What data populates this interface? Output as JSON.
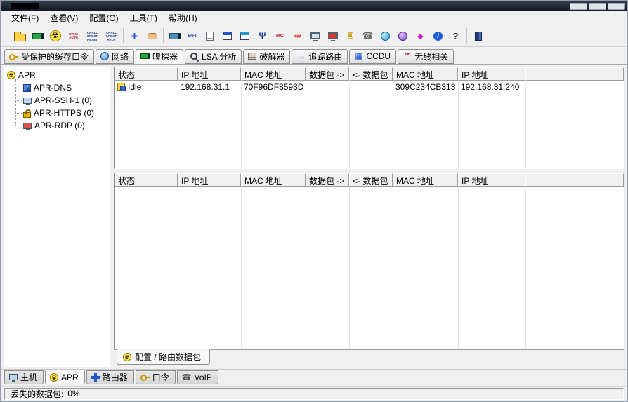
{
  "icons": {
    "radiation": "☢",
    "phone": "☎",
    "plus": "+",
    "b64": "B64",
    "fork": "Ψ",
    "mc": "MC",
    "asterisks": "***",
    "tower": "♜",
    "plug": "◆",
    "info": "i",
    "help": "?",
    "ntlm": "NTLM AUTH",
    "chall_reset": "CHALL SPOOF RESET",
    "chall_htlh": "CHALL SPOOF HTLH",
    "route_arrow": "→",
    "ccdu_grid": "▦",
    "wireless": "””"
  },
  "menubar": {
    "items": [
      {
        "label": "文件(F)"
      },
      {
        "label": "查看(V)"
      },
      {
        "label": "配置(O)"
      },
      {
        "label": "工具(T)"
      },
      {
        "label": "帮助(H)"
      }
    ]
  },
  "toolbar": {
    "buttons": [
      "open-file",
      "sniffer-toggle",
      "apr-toggle",
      "ntlm-auth",
      "chall-spoof-reset",
      "chall-spoof-htlh",
      "add-to-list",
      "hand-stamp",
      "network-card",
      "base64-decoder",
      "notes",
      "app-window-1",
      "app-window-2",
      "tuning-fork",
      "mc-tool",
      "password-reveal",
      "monitor",
      "monitor-red",
      "tower",
      "telephone",
      "globe",
      "sphere",
      "plug",
      "info",
      "help",
      "exit"
    ]
  },
  "tabs": {
    "active": "嗅探器",
    "items": [
      {
        "label": "受保护的缓存口令"
      },
      {
        "label": "网络"
      },
      {
        "label": "嗅探器"
      },
      {
        "label": "LSA 分析"
      },
      {
        "label": "破解器"
      },
      {
        "label": "追踪路由"
      },
      {
        "label": "CCDU"
      },
      {
        "label": "无线相关"
      }
    ]
  },
  "tree": {
    "root_label": "APR",
    "items": [
      {
        "label": "APR-DNS"
      },
      {
        "label": "APR-SSH-1 (0)"
      },
      {
        "label": "APR-HTTPS (0)"
      },
      {
        "label": "APR-RDP (0)"
      }
    ]
  },
  "sniffer": {
    "headers": [
      "状态",
      "IP 地址",
      "MAC 地址",
      "数据包 ->",
      "<- 数据包",
      "MAC 地址",
      "IP 地址"
    ],
    "rows": [
      {
        "cells": [
          "Idle",
          "192.168.31.1",
          "70F96DF8593D",
          "",
          "",
          "309C234CB313",
          "192.168.31.240"
        ]
      }
    ],
    "bottom_rows": []
  },
  "content_tab": {
    "label": "配置 / 路由数据包"
  },
  "bottom_tabs": {
    "active": "APR",
    "items": [
      {
        "label": "主机"
      },
      {
        "label": "APR"
      },
      {
        "label": "路由器"
      },
      {
        "label": "口令"
      },
      {
        "label": "VoIP"
      }
    ]
  },
  "statusbar": {
    "lost_packets_label": "丢失的数据包:",
    "lost_packets_value": "0%"
  }
}
